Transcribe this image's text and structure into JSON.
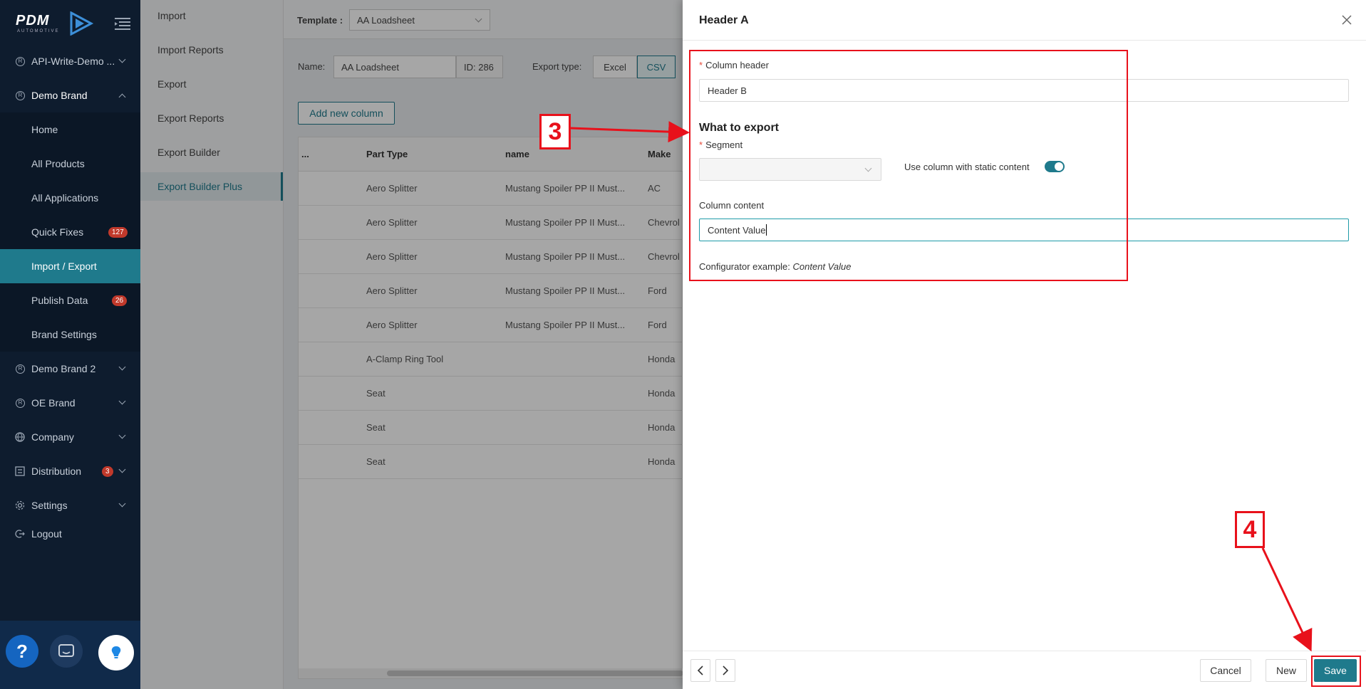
{
  "logo": {
    "main": "PDM",
    "sub": "AUTOMOTIVE"
  },
  "sidebar": {
    "items": [
      {
        "label": "API-Write-Demo ..."
      },
      {
        "label": "Demo Brand"
      },
      {
        "label": "Home"
      },
      {
        "label": "All Products"
      },
      {
        "label": "All Applications"
      },
      {
        "label": "Quick Fixes",
        "badge": "127"
      },
      {
        "label": "Import / Export"
      },
      {
        "label": "Publish Data",
        "badge": "26"
      },
      {
        "label": "Brand Settings"
      },
      {
        "label": "Demo Brand 2"
      },
      {
        "label": "OE Brand"
      },
      {
        "label": "Company"
      },
      {
        "label": "Distribution",
        "badge": "3"
      },
      {
        "label": "Settings"
      },
      {
        "label": "Logout"
      }
    ],
    "help_glyph": "?"
  },
  "subnav": {
    "items": [
      "Import",
      "Import Reports",
      "Export",
      "Export Reports",
      "Export Builder",
      "Export Builder Plus"
    ]
  },
  "main": {
    "template_label": "Template :",
    "template_value": "AA Loadsheet",
    "name_label": "Name:",
    "name_value": "AA Loadsheet",
    "id_text": "ID: 286",
    "export_type_label": "Export type:",
    "excel_label": "Excel",
    "csv_label": "CSV",
    "add_column_label": "Add new column",
    "grid": {
      "headers": [
        "...",
        "Part Type",
        "name",
        "Make"
      ],
      "rows": [
        [
          "Aero Splitter",
          "Mustang Spoiler PP II Must...",
          "AC"
        ],
        [
          "Aero Splitter",
          "Mustang Spoiler PP II Must...",
          "Chevrol"
        ],
        [
          "Aero Splitter",
          "Mustang Spoiler PP II Must...",
          "Chevrol"
        ],
        [
          "Aero Splitter",
          "Mustang Spoiler PP II Must...",
          "Ford"
        ],
        [
          "Aero Splitter",
          "Mustang Spoiler PP II Must...",
          "Ford"
        ],
        [
          "A-Clamp Ring Tool",
          "",
          "Honda"
        ],
        [
          "Seat",
          "",
          "Honda"
        ],
        [
          "Seat",
          "",
          "Honda"
        ],
        [
          "Seat",
          "",
          "Honda"
        ]
      ]
    }
  },
  "drawer": {
    "title": "Header A",
    "column_header_label": "Column header",
    "column_header_value": "Header B",
    "section_title": "What to export",
    "segment_label": "Segment",
    "static_label": "Use column with static content",
    "static_enabled": true,
    "column_content_label": "Column content",
    "column_content_value": "Content Value",
    "example_label": "Configurator example:",
    "example_value": "Content Value",
    "buttons": {
      "cancel": "Cancel",
      "new": "New",
      "save": "Save"
    }
  },
  "annotations": {
    "step3": "3",
    "step4": "4",
    "color": "#e8111b"
  },
  "colors": {
    "accent": "#1f7a8c",
    "sidebar_bg": "#0e1c2e",
    "badge": "#c0392b"
  }
}
